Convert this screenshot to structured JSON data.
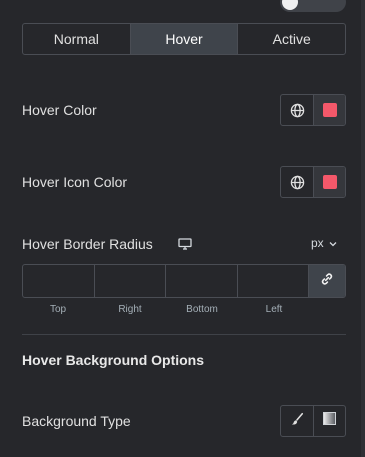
{
  "tabs": [
    {
      "label": "Normal",
      "active": false
    },
    {
      "label": "Hover",
      "active": true
    },
    {
      "label": "Active",
      "active": false
    }
  ],
  "hover_color": {
    "label": "Hover Color",
    "value": "#f4586a",
    "icon": "globe-icon"
  },
  "hover_icon_color": {
    "label": "Hover Icon Color",
    "value": "#f4586a",
    "icon": "globe-icon"
  },
  "border_radius": {
    "label": "Hover Border Radius",
    "device_icon": "desktop-icon",
    "unit": "px",
    "fields": [
      {
        "label": "Top",
        "value": ""
      },
      {
        "label": "Right",
        "value": ""
      },
      {
        "label": "Bottom",
        "value": ""
      },
      {
        "label": "Left",
        "value": ""
      }
    ],
    "link_icon": "link-icon"
  },
  "background_options": {
    "heading": "Hover Background Options",
    "type_label": "Background Type",
    "type_options": [
      "brush-icon",
      "gradient-icon"
    ]
  }
}
